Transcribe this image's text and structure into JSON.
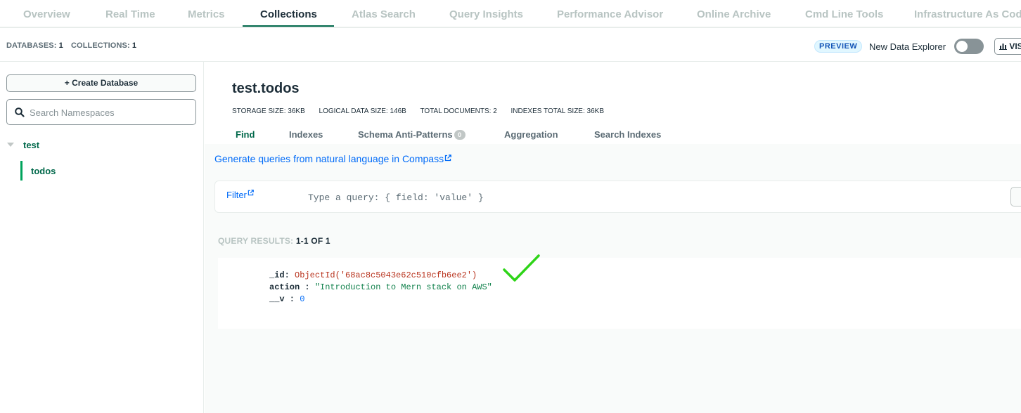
{
  "tabs": [
    {
      "label": "Overview"
    },
    {
      "label": "Real Time"
    },
    {
      "label": "Metrics"
    },
    {
      "label": "Collections",
      "active": true
    },
    {
      "label": "Atlas Search"
    },
    {
      "label": "Query Insights"
    },
    {
      "label": "Performance Advisor"
    },
    {
      "label": "Online Archive"
    },
    {
      "label": "Cmd Line Tools"
    },
    {
      "label": "Infrastructure As Code"
    }
  ],
  "subheader": {
    "databases_label": "DATABASES:",
    "databases_count": "1",
    "collections_label": "COLLECTIONS:",
    "collections_count": "1",
    "preview_badge": "PREVIEW",
    "new_data_explorer_label": "New Data Explorer",
    "new_data_explorer_enabled": false,
    "visualize_button": "VISUALIZE YOUR DATA",
    "visualize_icon": "bar-chart-icon"
  },
  "sidebar": {
    "create_database_label": "+ Create Database",
    "search_placeholder": "Search Namespaces",
    "search_icon": "search-icon",
    "databases": [
      {
        "name": "test",
        "collections": [
          {
            "name": "todos",
            "selected": true
          }
        ]
      }
    ]
  },
  "main": {
    "collection_title": "test.todos",
    "stats": [
      {
        "label": "STORAGE SIZE:",
        "value": "36KB"
      },
      {
        "label": "LOGICAL DATA SIZE:",
        "value": "146B"
      },
      {
        "label": "TOTAL DOCUMENTS:",
        "value": "2"
      },
      {
        "label": "INDEXES TOTAL SIZE:",
        "value": "36KB"
      }
    ],
    "subtabs": [
      {
        "label": "Find",
        "active": true
      },
      {
        "label": "Indexes"
      },
      {
        "label": "Schema Anti-Patterns",
        "badge": "0"
      },
      {
        "label": "Aggregation"
      },
      {
        "label": "Search Indexes"
      }
    ],
    "nl_link": "Generate queries from natural language in Compass",
    "filter_label": "Filter",
    "filter_placeholder": "Type a query: { field: 'value' }",
    "query_results_label": "QUERY RESULTS:",
    "query_results_value": "1-1 OF 1",
    "document": {
      "fields": [
        {
          "key": "_id",
          "value": "ObjectId('68ac8c5043e62c510cfb6ee2')",
          "type": "oid"
        },
        {
          "key": "action",
          "value": "\"Introduction to Mern stack on AWS\"",
          "type": "string"
        },
        {
          "key": "__v",
          "value": "0",
          "type": "number"
        }
      ]
    },
    "annotation_icon": "checkmark-icon",
    "annotation_color": "#2ed418"
  },
  "colors": {
    "brand_green": "#00684a",
    "link_blue": "#016bf8"
  }
}
